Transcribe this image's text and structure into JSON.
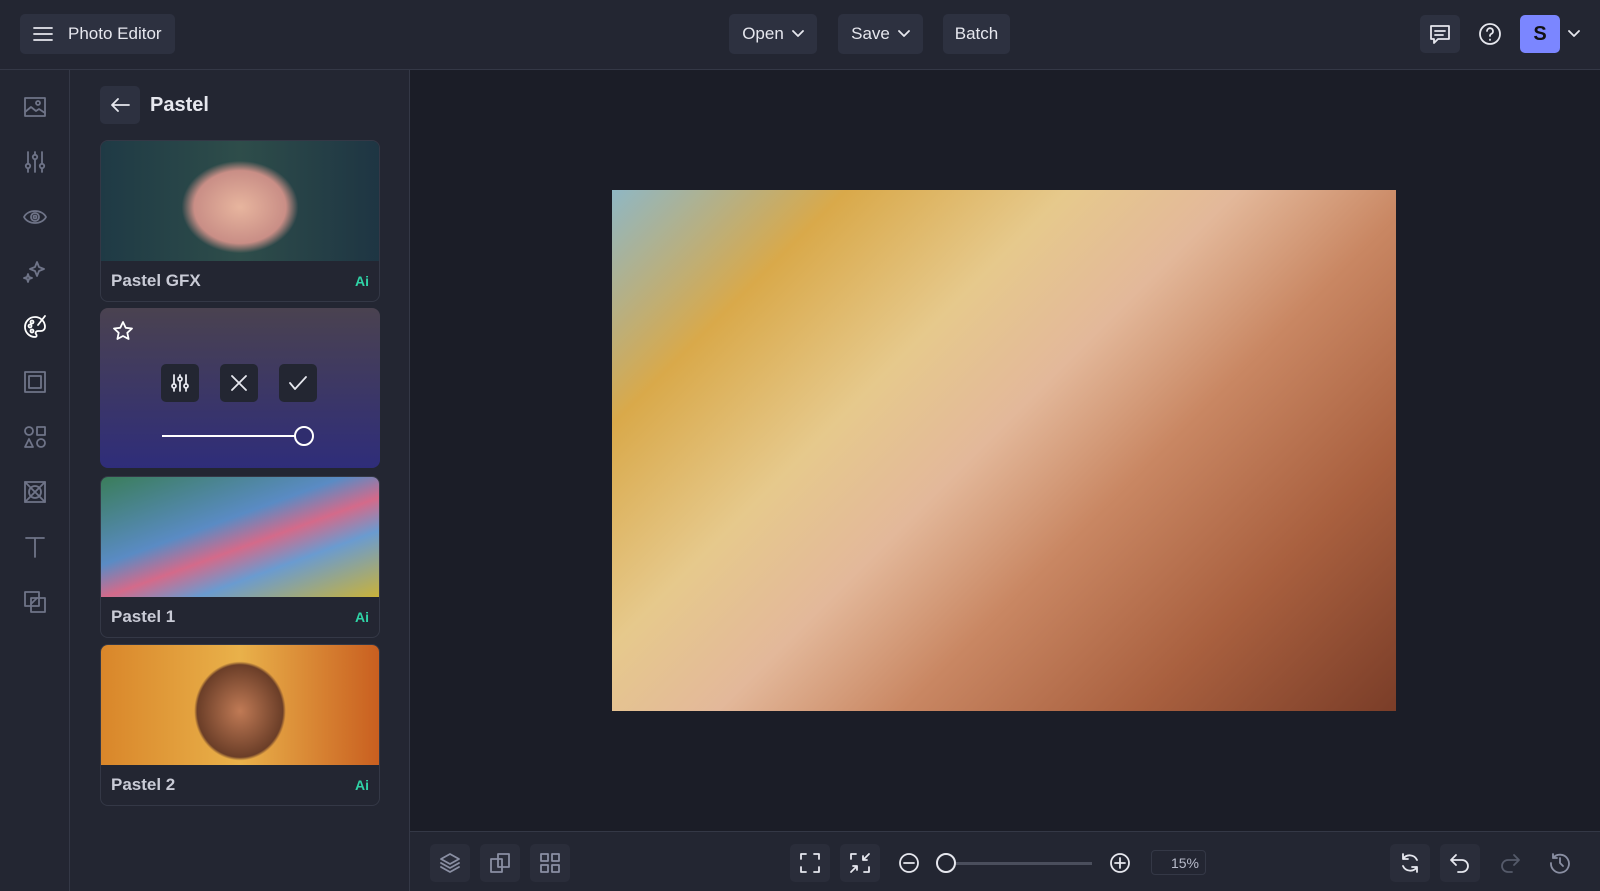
{
  "app": {
    "title": "Photo Editor"
  },
  "toolbar": {
    "open": "Open",
    "save": "Save",
    "batch": "Batch",
    "avatar_initial": "S"
  },
  "panel": {
    "title": "Pastel",
    "items": [
      {
        "label": "Pastel GFX",
        "badge": "Ai"
      },
      {
        "label": "Pastel 1",
        "badge": "Ai"
      },
      {
        "label": "Pastel 2",
        "badge": "Ai"
      }
    ],
    "intensity": 1.0
  },
  "zoom": {
    "value": "15%",
    "slider": 0.0
  },
  "colors": {
    "accent": "#7b86ff",
    "ai": "#2fd3a6"
  }
}
